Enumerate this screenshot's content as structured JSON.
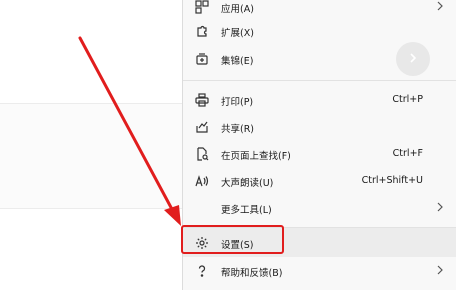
{
  "menu": {
    "items": [
      {
        "icon": "apps-icon",
        "label": "应用(A)",
        "shortcut": "",
        "submenu": true
      },
      {
        "icon": "extensions-icon",
        "label": "扩展(X)",
        "shortcut": "",
        "submenu": false
      },
      {
        "icon": "collections-icon",
        "label": "集锦(E)",
        "shortcut": "",
        "submenu": false
      },
      {
        "icon": "print-icon",
        "label": "打印(P)",
        "shortcut": "Ctrl+P",
        "submenu": false
      },
      {
        "icon": "share-icon",
        "label": "共享(R)",
        "shortcut": "",
        "submenu": false
      },
      {
        "icon": "find-on-page-icon",
        "label": "在页面上查找(F)",
        "shortcut": "Ctrl+F",
        "submenu": false
      },
      {
        "icon": "read-aloud-icon",
        "label": "大声朗读(U)",
        "shortcut": "Ctrl+Shift+U",
        "submenu": false
      },
      {
        "icon": "",
        "label": "更多工具(L)",
        "shortcut": "",
        "submenu": true
      },
      {
        "icon": "gear-icon",
        "label": "设置(S)",
        "shortcut": "",
        "submenu": false,
        "highlighted": true
      },
      {
        "icon": "help-icon",
        "label": "帮助和反馈(B)",
        "shortcut": "",
        "submenu": true
      }
    ]
  },
  "colors": {
    "annotation_red": "#e11d1d",
    "menu_background": "#f8f8f8",
    "hover_background": "#ececec"
  }
}
